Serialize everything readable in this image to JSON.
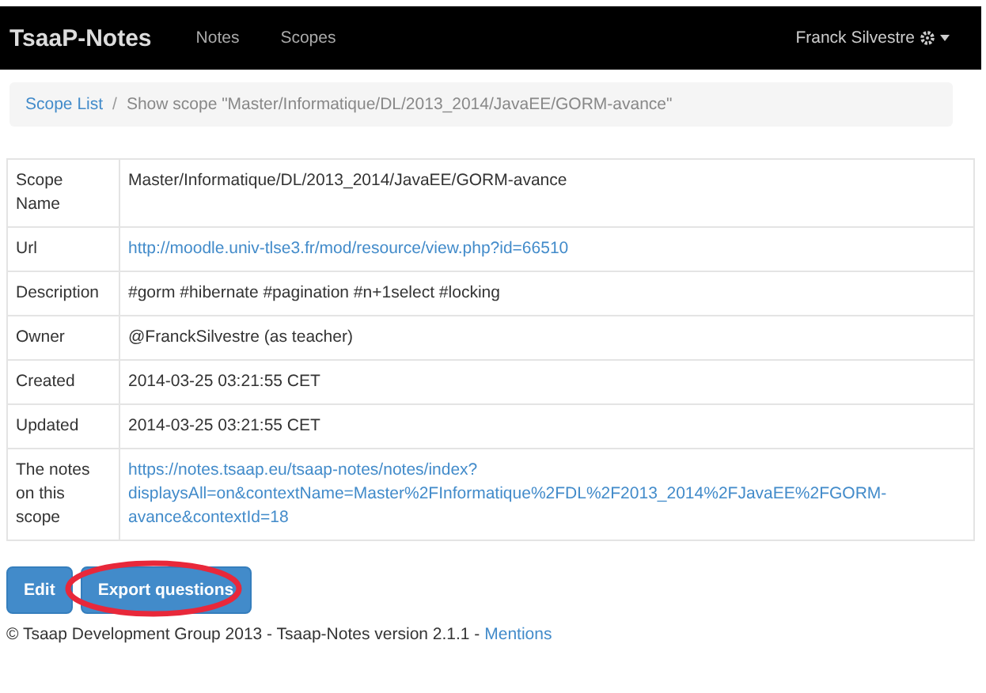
{
  "navbar": {
    "brand": "TsaaP-Notes",
    "links": [
      {
        "label": "Notes",
        "selected": false
      },
      {
        "label": "Scopes",
        "selected": false
      }
    ],
    "user": "Franck Silvestre"
  },
  "breadcrumb": {
    "link": "Scope List",
    "separator": "/",
    "current": "Show scope \"Master/Informatique/DL/2013_2014/JavaEE/GORM-avance\""
  },
  "details": [
    {
      "label": "Scope Name",
      "value": "Master/Informatique/DL/2013_2014/JavaEE/GORM-avance",
      "kind": "text"
    },
    {
      "label": "Url",
      "value": "http://moodle.univ-tlse3.fr/mod/resource/view.php?id=66510",
      "kind": "link"
    },
    {
      "label": "Description",
      "value": "#gorm #hibernate #pagination #n+1select #locking",
      "kind": "text"
    },
    {
      "label": "Owner",
      "value": "@FranckSilvestre (as teacher)",
      "kind": "text"
    },
    {
      "label": "Created",
      "value": "2014-03-25 03:21:55 CET",
      "kind": "text"
    },
    {
      "label": "Updated",
      "value": "2014-03-25 03:21:55 CET",
      "kind": "text"
    },
    {
      "label": "The notes on this scope",
      "value": "https://notes.tsaap.eu/tsaap-notes/notes/index?displaysAll=on&contextName=Master%2FInformatique%2FDL%2F2013_2014%2FJavaEE%2FGORM-avance&contextId=18",
      "kind": "link"
    }
  ],
  "buttons": [
    {
      "label": "Edit",
      "highlighted": false
    },
    {
      "label": "Export questions",
      "highlighted": true
    }
  ],
  "footer": {
    "text": "© Tsaap Development Group 2013 - Tsaap-Notes version 2.1.1 - ",
    "link": "Mentions"
  }
}
